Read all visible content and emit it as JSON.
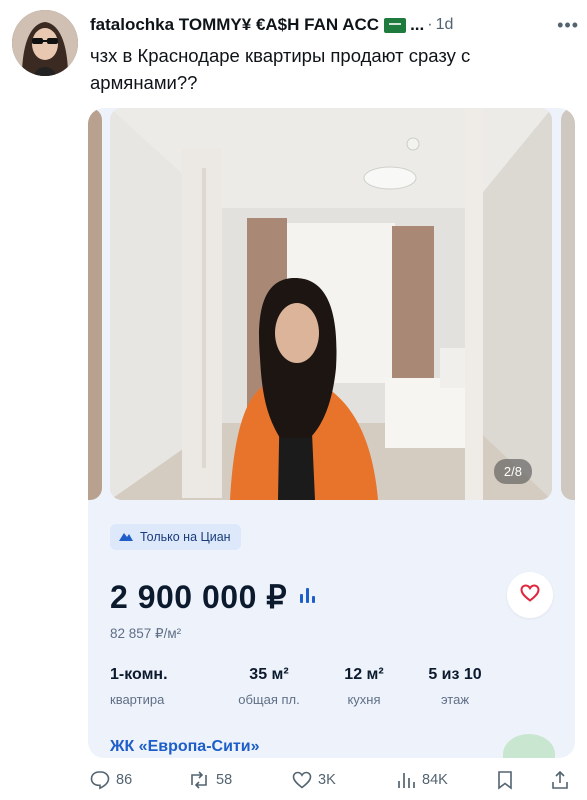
{
  "tweet": {
    "author_name": "fatalochka TOMMY¥ €A$H FAN ACC",
    "truncation": "...",
    "separator": "·",
    "time": "1d",
    "text": "чзх в Краснодаре квартиры продают сразу с армянами??"
  },
  "listing": {
    "photo_counter": "2/8",
    "badge_label": "Только на Циан",
    "price": "2 900 000 ₽",
    "price_per_m2": "82 857 ₽/м²",
    "specs": [
      {
        "value": "1-комн.",
        "label": "квартира"
      },
      {
        "value": "35 м²",
        "label": "общая пл."
      },
      {
        "value": "12 м²",
        "label": "кухня"
      },
      {
        "value": "5 из 10",
        "label": "этаж"
      }
    ],
    "complex_name": "ЖК «Европа-Сити»",
    "accent_color": "#1d5ec9",
    "favorite_color": "#e0253c"
  },
  "actions": {
    "replies": "86",
    "retweets": "58",
    "likes": "3K",
    "views": "84K"
  },
  "icons": [
    "more-icon",
    "flag-icon",
    "pin-icon",
    "chart-icon",
    "heart-icon",
    "reply-icon",
    "retweet-icon",
    "like-icon",
    "views-icon",
    "bookmark-icon",
    "share-icon"
  ]
}
